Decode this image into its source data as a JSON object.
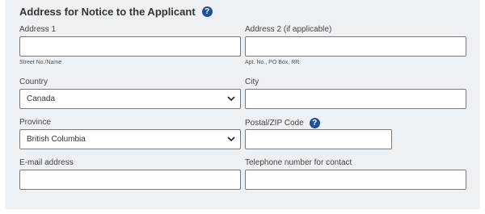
{
  "section": {
    "title": "Address for Notice to the Applicant",
    "help_symbol": "?"
  },
  "fields": {
    "address1": {
      "label": "Address 1",
      "value": "",
      "hint": "Street No./Name"
    },
    "address2": {
      "label": "Address 2 (if applicable)",
      "value": "",
      "hint": "Apt. No., PO Box, RR"
    },
    "country": {
      "label": "Country",
      "selected": "Canada"
    },
    "city": {
      "label": "City",
      "value": ""
    },
    "province": {
      "label": "Province",
      "selected": "British Columbia"
    },
    "postal": {
      "label": "Postal/ZIP Code",
      "value": "",
      "help_symbol": "?"
    },
    "email": {
      "label": "E-mail address",
      "value": ""
    },
    "telephone": {
      "label": "Telephone number for contact",
      "value": ""
    }
  },
  "icons": {
    "help": "question-circle-icon",
    "dropdown": "chevron-down-icon"
  },
  "colors": {
    "panel_background": "#eef1f4",
    "help_icon": "#1f4e9c",
    "input_border": "#7a7a7a"
  }
}
